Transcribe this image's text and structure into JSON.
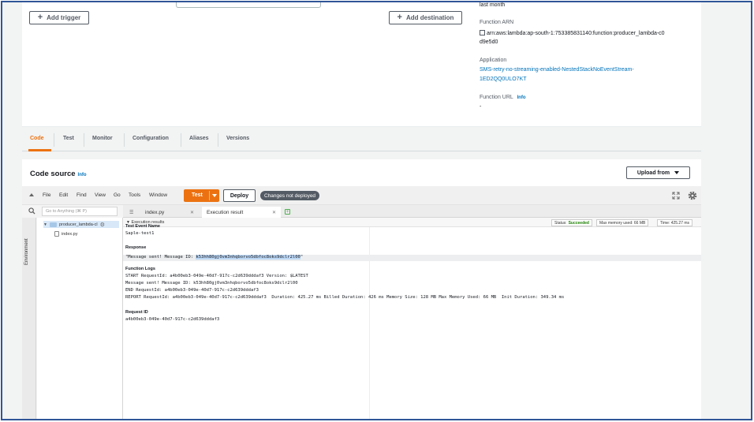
{
  "top": {
    "add_trigger": "Add trigger",
    "add_destination": "Add destination",
    "last_modified_tail": "last month",
    "function_arn_label": "Function ARN",
    "function_arn_line1": "arn:aws:lambda:ap-south-1:753385831140:function:producer_lambda-c0",
    "function_arn_line2": "d9e5d0",
    "application_label": "Application",
    "application_line1": "SMS-retry-no-streaming-enabled-NestedStackNoEventStream-",
    "application_line2": "1ED2QQ0ULO7KT",
    "function_url_label": "Function URL",
    "function_url_info": "Info",
    "function_url_value": "-"
  },
  "tabs": [
    "Code",
    "Test",
    "Monitor",
    "Configuration",
    "Aliases",
    "Versions"
  ],
  "code_source": {
    "title": "Code source",
    "info": "Info",
    "upload": "Upload from"
  },
  "ide": {
    "menus": [
      "File",
      "Edit",
      "Find",
      "View",
      "Go",
      "Tools",
      "Window"
    ],
    "test": "Test",
    "deploy": "Deploy",
    "badge": "Changes not deployed",
    "search_placeholder": "Go to Anything (⌘ P)",
    "environment": "Environment",
    "tree_folder": "producer_lambda-cl",
    "tree_file": "index.py",
    "editor_tabs": [
      "index.py",
      "Execution result"
    ]
  },
  "results": {
    "title": "Execution results",
    "status_label": "Status:",
    "status_value": "Succeeded",
    "memory": "Max memory used: 66 MB",
    "time": "Time: 425.27 ms",
    "test_event_label": "Test Event Name",
    "test_event_value": "Saple-test1",
    "response_label": "Response",
    "response_prefix": "\"Message sent! Message ID: ",
    "response_id": "k53hh80gj0vm3nhqborvo5dbfoc8oks9dclr2l00",
    "response_suffix": "\"",
    "logs_label": "Function Logs",
    "logs": [
      "START RequestId: a4b00eb3-049e-40d7-917c-c2d639dddaf3 Version: $LATEST",
      "Message sent! Message ID: k53hh80gj0vm3nhqborvo5dbfoc8oks9dclr2l00",
      "END RequestId: a4b00eb3-049e-40d7-917c-c2d639dddaf3",
      "REPORT RequestId: a4b00eb3-049e-40d7-917c-c2d639dddaf3  Duration: 425.27 ms Billed Duration: 426 ms Memory Size: 128 MB Max Memory Used: 66 MB  Init Duration: 349.34 ms"
    ],
    "request_id_label": "Request ID",
    "request_id_value": "a4b00eb3-049e-40d7-917c-c2d639dddaf3"
  },
  "colors": {
    "accent": "#ec7211",
    "link": "#0073bb",
    "success": "#1d8102"
  }
}
